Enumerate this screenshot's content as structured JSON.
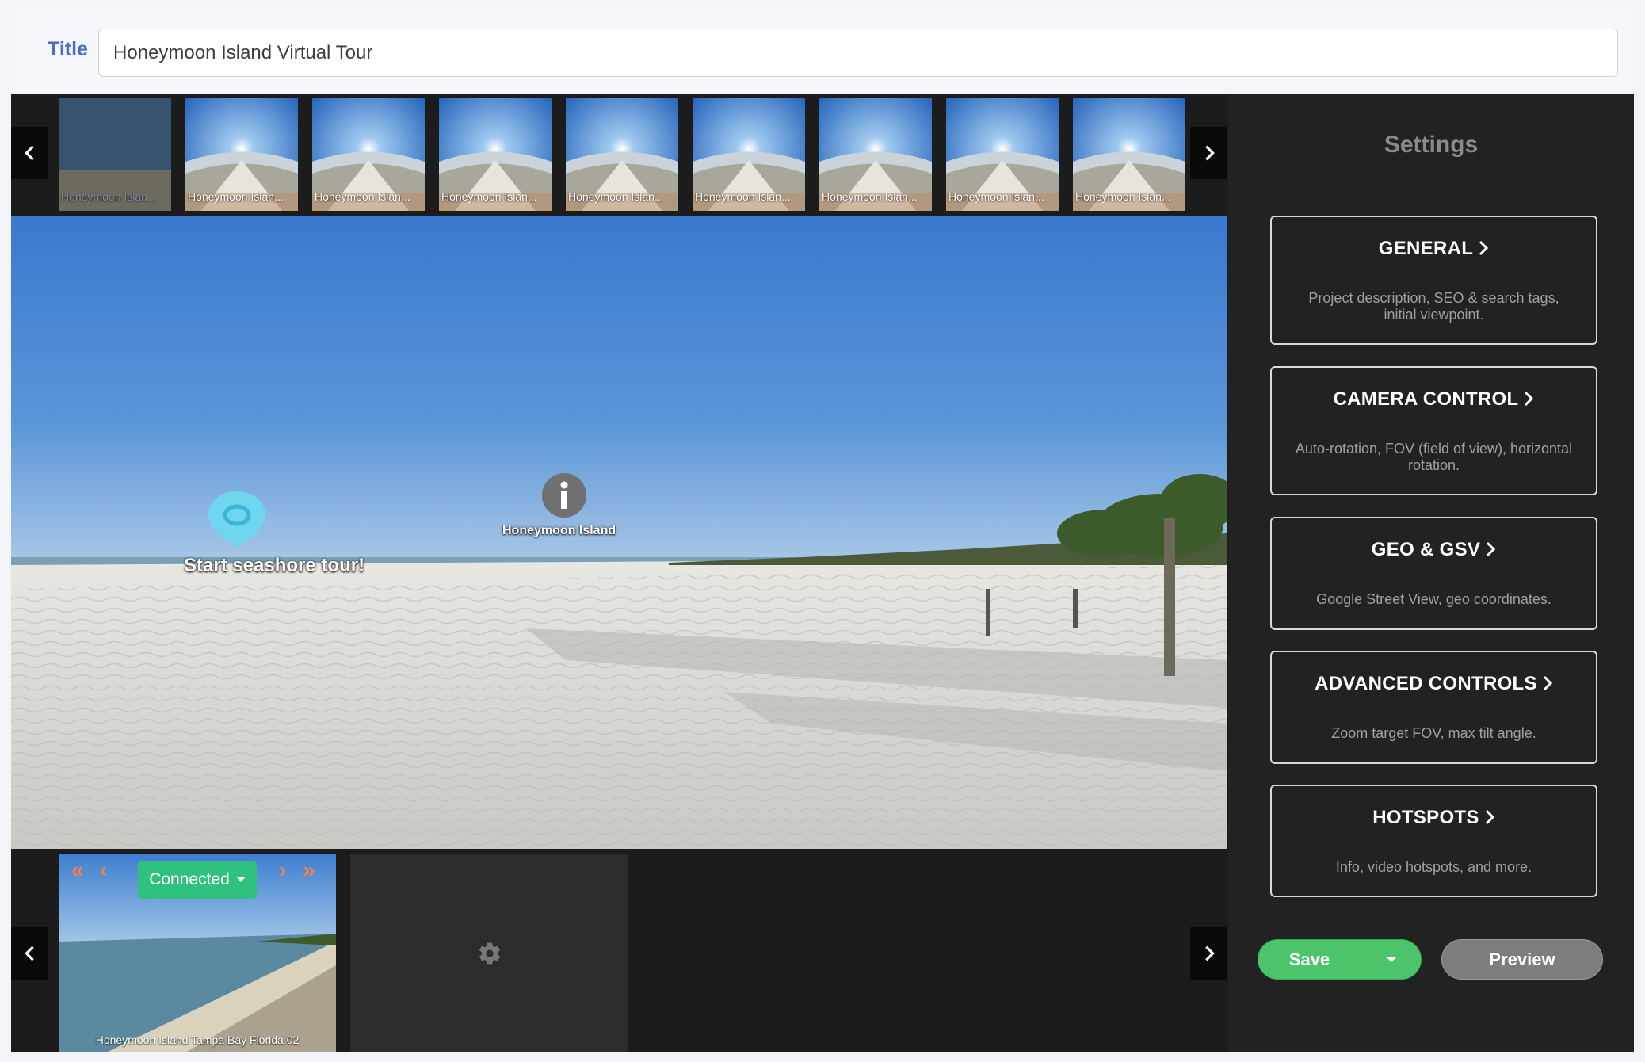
{
  "title_field": {
    "label": "Title",
    "value": "Honeymoon Island Virtual Tour"
  },
  "thumbnails": [
    {
      "label": "Honeymoon Islan..."
    },
    {
      "label": "Honeymoon Islan..."
    },
    {
      "label": "Honeymoon Islan..."
    },
    {
      "label": "Honeymoon Islan..."
    },
    {
      "label": "Honeymoon Islan..."
    },
    {
      "label": "Honeymoon Islan..."
    },
    {
      "label": "Honeymoon Islan..."
    },
    {
      "label": "Honeymoon Islan..."
    },
    {
      "label": "Honeymoon Islan..."
    }
  ],
  "viewer": {
    "hotspots": [
      {
        "label": "Start seashore tour!",
        "icon": "location-pin-icon"
      },
      {
        "label": "Honeymoon Island",
        "icon": "info-icon"
      }
    ]
  },
  "bottom_strip": {
    "connected_label": "Connected",
    "scene_caption": "Honeymoon Island Tampa Bay Florida 02",
    "empty_icon": "gear-icon"
  },
  "settings": {
    "title": "Settings",
    "cards": [
      {
        "heading": "GENERAL",
        "description": "Project description, SEO & search tags, initial viewpoint."
      },
      {
        "heading": "CAMERA CONTROL",
        "description": "Auto-rotation, FOV (field of view), horizontal rotation."
      },
      {
        "heading": "GEO & GSV",
        "description": "Google Street View, geo coordinates."
      },
      {
        "heading": "ADVANCED CONTROLS",
        "description": "Zoom target FOV, max tilt angle."
      },
      {
        "heading": "HOTSPOTS",
        "description": "Info, video hotspots, and more."
      }
    ]
  },
  "actions": {
    "save_label": "Save",
    "preview_label": "Preview"
  },
  "colors": {
    "accent_title": "#4a6ccc",
    "save_green": "#4cc46a",
    "connected_green": "#2ec27e",
    "orange_arrows": "#f0824a"
  }
}
